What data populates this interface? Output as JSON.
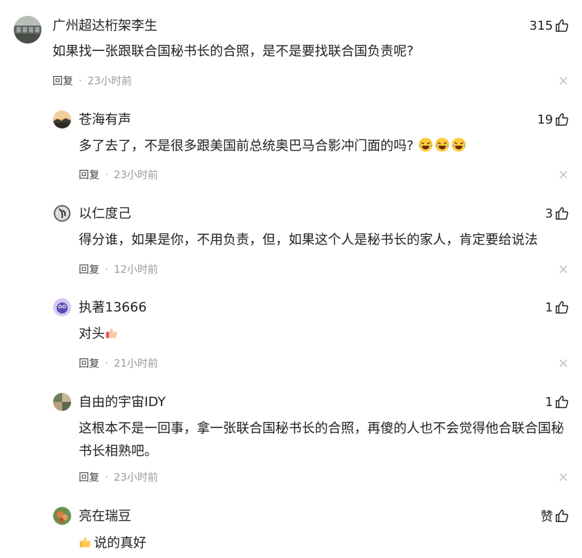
{
  "comments": [
    {
      "user": "广州超达桁架李生",
      "likes": "315",
      "text": "如果找一张跟联合国秘书长的合照，是不是要找联合国负责呢?",
      "reply_label": "回复",
      "separator": "·",
      "time": "23小时前"
    },
    {
      "user": "苍海有声",
      "likes": "19",
      "text": "多了去了，不是很多跟美国前总统奥巴马合影冲门面的吗?",
      "emojis": [
        "laughing-crying-icon",
        "laughing-crying-icon",
        "laughing-crying-icon"
      ],
      "reply_label": "回复",
      "separator": "·",
      "time": "23小时前"
    },
    {
      "user": "以仁度己",
      "likes": "3",
      "text": "得分谁，如果是你，不用负责，但，如果这个人是秘书长的家人，肯定要给说法",
      "reply_label": "回复",
      "separator": "·",
      "time": "12小时前"
    },
    {
      "user": "执著13666",
      "likes": "1",
      "text": "对头",
      "trailing_emoji": "thumbs-up-icon",
      "reply_label": "回复",
      "separator": "·",
      "time": "21小时前"
    },
    {
      "user": "自由的宇宙IDY",
      "likes": "1",
      "text_line1": "这根本不是一回事，拿一张联合国秘书长的合照，再傻的人也不会觉得他合联合国秘",
      "text_line2": "书长相熟吧。",
      "reply_label": "回复",
      "separator": "·",
      "time": "23小时前"
    },
    {
      "user": "亮在瑞豆",
      "likes": "赞",
      "leading_emoji": "thumbs-up-icon",
      "text": "说的真好"
    }
  ],
  "icons": {
    "like": "thumbs-up-outline-icon",
    "close": "close-icon"
  },
  "colors": {
    "text": "#222222",
    "meta": "#9a9a9a",
    "close": "#c4c4c4"
  }
}
